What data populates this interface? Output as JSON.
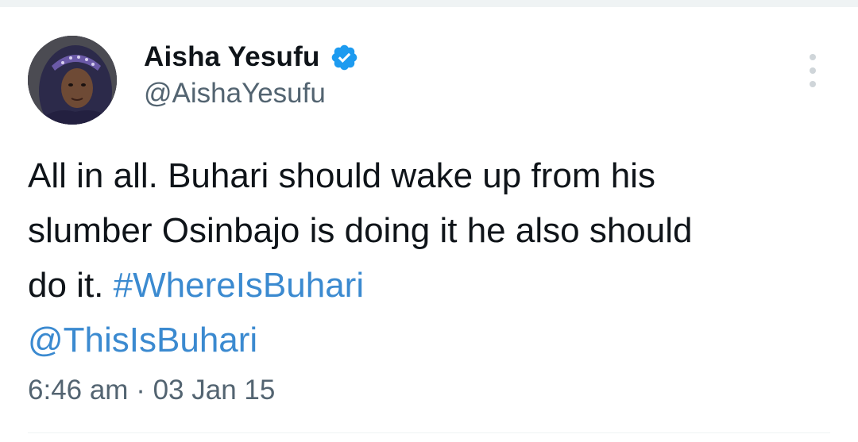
{
  "author": {
    "display_name": "Aisha Yesufu",
    "handle": "@AishaYesufu",
    "verified": true,
    "verified_color": "#1d9bf0"
  },
  "tweet": {
    "line1": "All in all. Buhari should wake up from his",
    "line2": "slumber Osinbajo is doing it he also should",
    "line3_text": "do it. ",
    "hashtag": "#WhereIsBuhari",
    "mention": "@ThisIsBuhari",
    "link_color": "#3b8ad0"
  },
  "meta": {
    "time": "6:46 am",
    "separator": "·",
    "date": "03 Jan 15"
  },
  "icons": {
    "more": "more-vertical-icon",
    "verified": "verified-badge-icon"
  }
}
